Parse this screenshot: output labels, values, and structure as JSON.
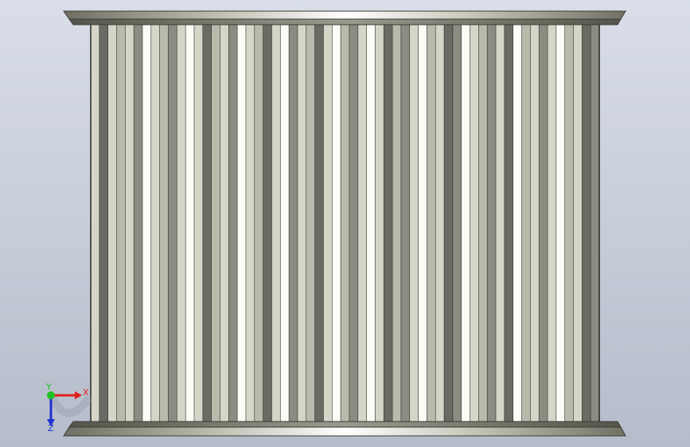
{
  "viewport": {
    "background_top": "#d9dee8",
    "background_bottom": "#b5bcca"
  },
  "model": {
    "name": "",
    "view": "front",
    "flange_color": "#cfcfc2",
    "flange_highlight": "#ffffff",
    "flange_shadow": "#4a4a40",
    "tooth_palette": {
      "w": "#fcfcf7",
      "l": "#d5d5c8",
      "m": "#b9b9ac",
      "d": "#8c8c82",
      "x": "#6b6b63"
    },
    "tooth_pattern": "lxlmldwlmdlwlxmldwlmxlwdlmxlwmdlwlxmdlwmlxdwlmdlxwmldlwmlxd"
  },
  "triad": {
    "x_label": "X",
    "y_label": "Y",
    "x_color": "#e02020",
    "y_color": "#20c020",
    "z_color": "#2030d0",
    "z_label": "Z"
  }
}
